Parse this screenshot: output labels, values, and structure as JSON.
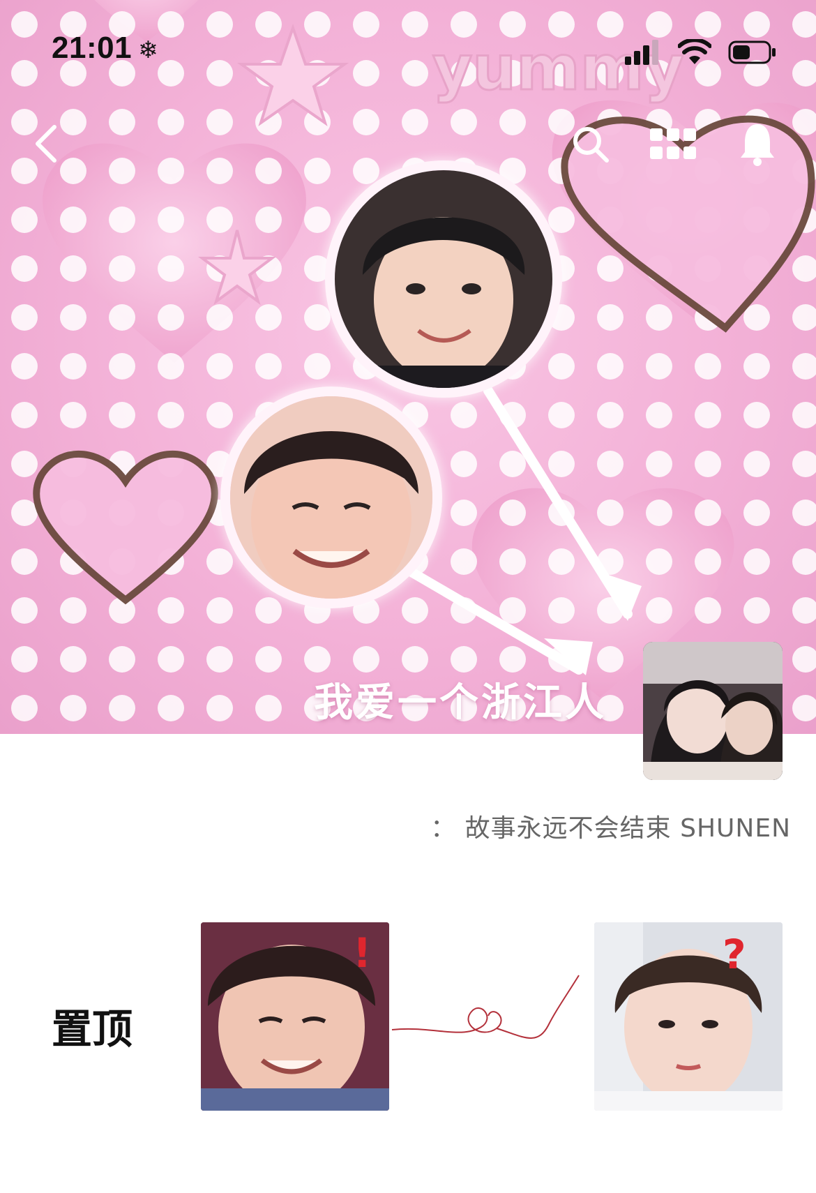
{
  "status_bar": {
    "time": "21:01",
    "weather_icon": "snowflake-icon",
    "signal_icon": "cellular-signal-icon",
    "wifi_icon": "wifi-icon",
    "battery_icon": "battery-icon"
  },
  "nav": {
    "back_icon": "chevron-left-icon",
    "search_icon": "search-icon",
    "grid_icon": "grid-menu-icon",
    "bell_icon": "bell-icon"
  },
  "cover": {
    "watermark": "yummy",
    "title": "我爱一个浙江人"
  },
  "profile": {
    "bio": "： 故事永远不会结束 SHUNEN"
  },
  "pinned": {
    "label": "置顶",
    "left_badge": "!",
    "right_badge": "?"
  },
  "colors": {
    "cover_pink": "#f3b1d7",
    "text_dark": "#111111",
    "bio_gray": "#666666",
    "badge_red": "#e0262e"
  }
}
